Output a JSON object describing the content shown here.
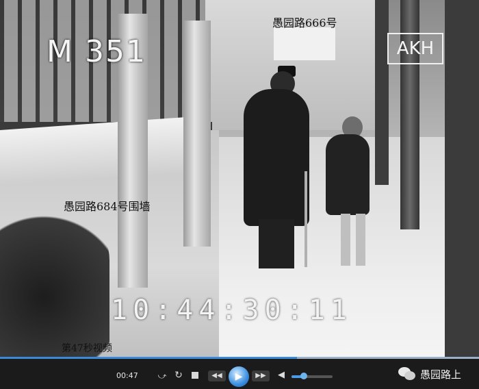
{
  "video": {
    "reel_code": "M 351",
    "logo_text": "AKH",
    "timecode": "10:44:30:11",
    "captions": {
      "road": "愚园路666号",
      "wall": "愚园路684号围墙",
      "seconds": "第47秒视频"
    }
  },
  "player": {
    "time_elapsed": "00:47",
    "progress": 0.62,
    "volume": 0.3,
    "icons": [
      "rate-icon",
      "loop-icon",
      "stop-icon",
      "rewind-icon",
      "play-icon",
      "forward-icon",
      "volume-icon"
    ],
    "accent_color": "#3a8ad8"
  },
  "watermark": {
    "account_name": "愚园路上",
    "icon": "wechat-icon"
  }
}
